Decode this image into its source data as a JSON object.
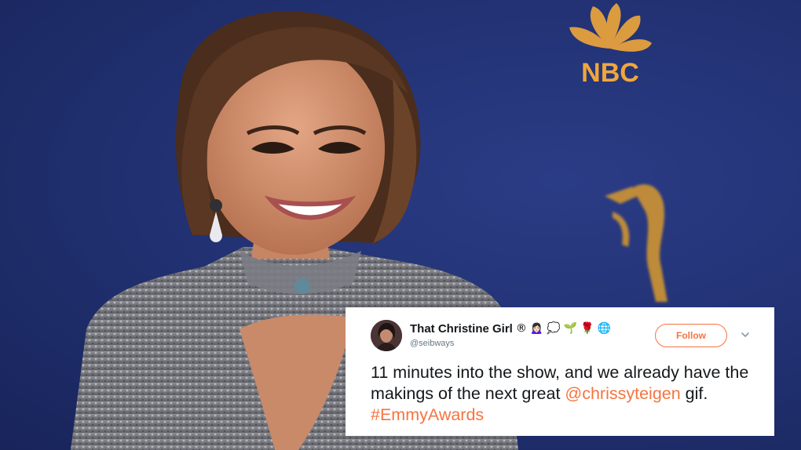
{
  "tweet": {
    "display_name": "That Christine Girl",
    "badges": [
      "®",
      "🙍🏻‍♀️",
      "💭",
      "🌱",
      "🌹",
      "🌐"
    ],
    "handle": "@seibways",
    "follow_label": "Follow",
    "text_part1": "11 minutes into the show, and we already have the makings of the next great ",
    "mention": "@chrissyteigen",
    "text_part2": " gif. ",
    "hashtag": "#EmmyAwards"
  },
  "background": {
    "logo_text": "NBC"
  },
  "colors": {
    "accent": "#f6743f",
    "backdrop": "#223274",
    "text": "#14171a",
    "muted": "#657786"
  }
}
